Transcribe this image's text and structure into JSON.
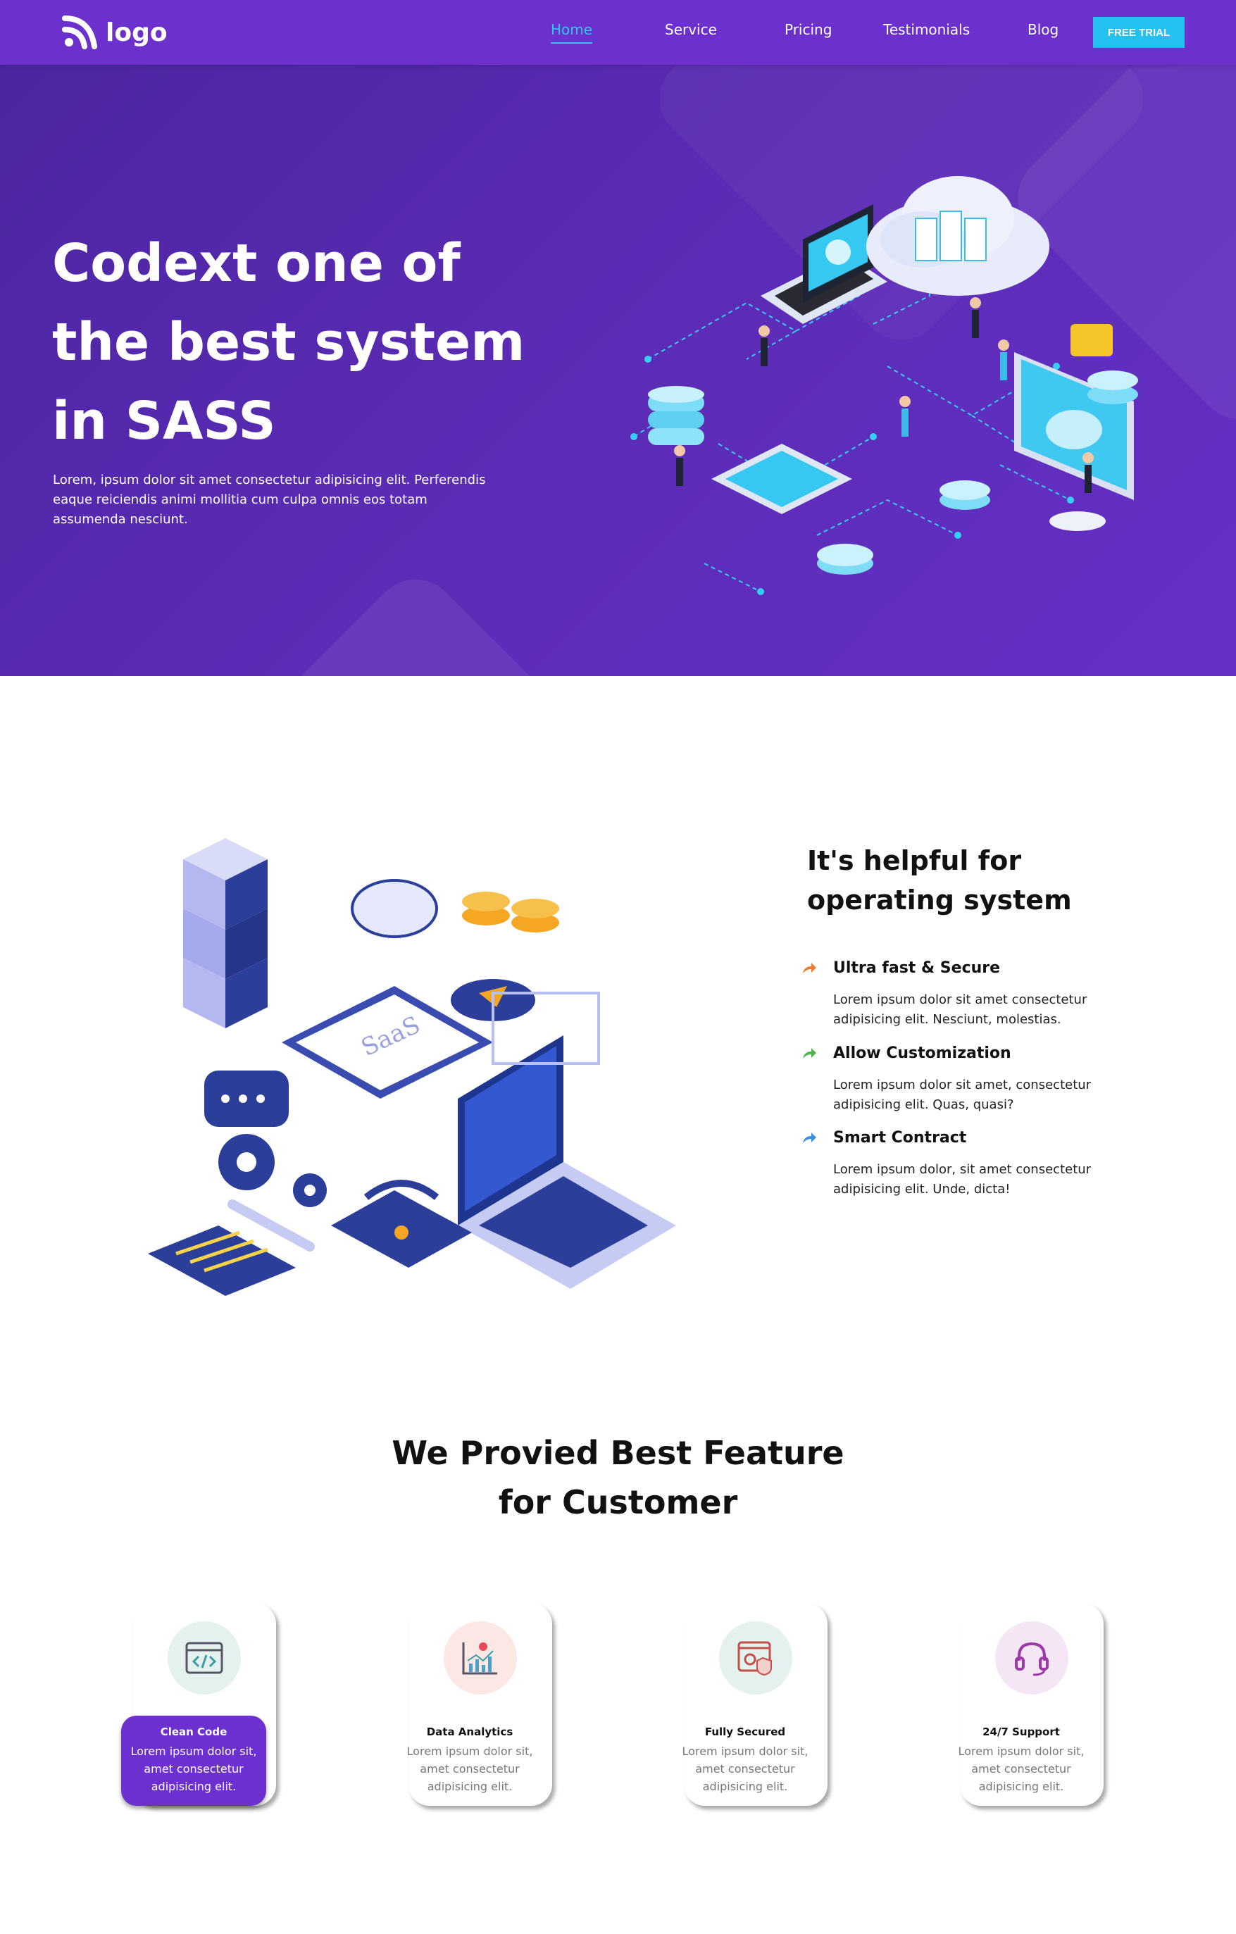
{
  "nav": {
    "logo_text": "logo",
    "items": [
      {
        "label": "Home",
        "active": true
      },
      {
        "label": "Service",
        "active": false
      },
      {
        "label": "Pricing",
        "active": false
      },
      {
        "label": "Testimonials",
        "active": false
      },
      {
        "label": "Blog",
        "active": false
      }
    ],
    "cta_label": "FREE TRIAL"
  },
  "hero": {
    "title_lines": [
      "Codext one of",
      "the best system",
      "in SASS"
    ],
    "description": "Lorem, ipsum dolor sit amet consectetur adipisicing elit. Perferendis eaque reiciendis animi mollitia cum culpa omnis eos totam assumenda nesciunt."
  },
  "system": {
    "title": "It's helpful for operating system",
    "features": [
      {
        "title": "Ultra fast & Secure",
        "desc": "Lorem ipsum dolor sit amet consectetur adipisicing elit. Nesciunt, molestias.",
        "arrow_color": "#f07a30",
        "icon": "arrow-icon"
      },
      {
        "title": "Allow Customization",
        "desc": "Lorem ipsum dolor sit amet, consectetur adipisicing elit. Quas, quasi?",
        "arrow_color": "#4cb84c",
        "icon": "arrow-icon"
      },
      {
        "title": "Smart Contract",
        "desc": "Lorem ipsum dolor, sit amet consectetur adipisicing elit. Unde, dicta!",
        "arrow_color": "#3a8ee8",
        "icon": "arrow-icon"
      }
    ]
  },
  "features": {
    "title_lines": [
      "We Provied Best Feature",
      "for Customer"
    ],
    "cards": [
      {
        "title": "Clean Code",
        "desc": "Lorem ipsum dolor sit, amet consectetur adipisicing elit.",
        "icon": "code-icon",
        "icon_bg": "#e4f1ef",
        "active": true
      },
      {
        "title": "Data Analytics",
        "desc": "Lorem ipsum dolor sit, amet consectetur adipisicing elit.",
        "icon": "analytics-icon",
        "icon_bg": "#fbe8e4",
        "active": false
      },
      {
        "title": "Fully Secured",
        "desc": "Lorem ipsum dolor sit, amet consectetur adipisicing elit.",
        "icon": "security-icon",
        "icon_bg": "#e4f1ef",
        "active": false
      },
      {
        "title": "24/7 Support",
        "desc": "Lorem ipsum dolor sit, amet consectetur adipisicing elit.",
        "icon": "headset-icon",
        "icon_bg": "#f4e6f4",
        "active": false
      }
    ]
  },
  "colors": {
    "hero_bg": "#5a2bb3",
    "nav_bg": "#6c31cc",
    "accent": "#23c0f0",
    "card_active": "#6c2fd0"
  }
}
